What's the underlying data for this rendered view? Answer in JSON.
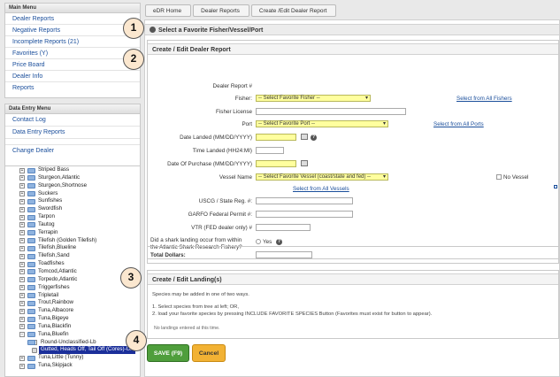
{
  "sidebar": {
    "main_menu": {
      "title": "Main Menu",
      "items": [
        "Dealer Reports",
        "Negative Reports",
        "Incomplete Reports (21)",
        "Favorites (Y)",
        "Price Board",
        "Dealer Info",
        "Reports"
      ]
    },
    "entry_menu": {
      "title": "Data Entry Menu",
      "items": [
        "Contact Log",
        "Data Entry Reports",
        "Change Dealer"
      ]
    },
    "species_tree": [
      {
        "label": "Striped Bass",
        "toggle": "+"
      },
      {
        "label": "Sturgeon,Atlantic",
        "toggle": "+"
      },
      {
        "label": "Sturgeon,Shortnose",
        "toggle": "+"
      },
      {
        "label": "Suckers",
        "toggle": "+"
      },
      {
        "label": "Sunfishes",
        "toggle": "+"
      },
      {
        "label": "Swordfish",
        "toggle": "+"
      },
      {
        "label": "Tarpon",
        "toggle": "+"
      },
      {
        "label": "Tautog",
        "toggle": "+"
      },
      {
        "label": "Terrapin",
        "toggle": "+"
      },
      {
        "label": "Tilefish (Golden Tilefish)",
        "toggle": "+"
      },
      {
        "label": "Tilefish,Blueline",
        "toggle": "+"
      },
      {
        "label": "Tilefish,Sand",
        "toggle": "+"
      },
      {
        "label": "Toadfishes",
        "toggle": "+"
      },
      {
        "label": "Tomcod,Atlantic",
        "toggle": "+"
      },
      {
        "label": "Torpedo,Atlantic",
        "toggle": "+"
      },
      {
        "label": "Triggerfishes",
        "toggle": "+"
      },
      {
        "label": "Tripletail",
        "toggle": "+"
      },
      {
        "label": "Trout,Rainbow",
        "toggle": "+"
      },
      {
        "label": "Tuna,Albacore",
        "toggle": "+"
      },
      {
        "label": "Tuna,Bigeye",
        "toggle": "+"
      },
      {
        "label": "Tuna,Blackfin",
        "toggle": "+"
      },
      {
        "label": "Tuna,Bluefin",
        "toggle": "−"
      },
      {
        "label": "Round-Unclassified-Lb",
        "toggle": "+",
        "child": true
      },
      {
        "label": "Gutted, Heads Off, Tail Off (Cores)-Un",
        "toggle": "",
        "child": true,
        "selected": true
      },
      {
        "label": "Tuna,Little (Tunny)",
        "toggle": "+"
      },
      {
        "label": "Tuna,Skipjack",
        "toggle": "+"
      }
    ]
  },
  "breadcrumb": [
    "eDR Home",
    "Dealer Reports",
    "Create /Edit Dealer Report"
  ],
  "favorite_section": {
    "title": "Select a Favorite Fisher/Vessel/Port"
  },
  "report_section": {
    "title": "Create / Edit Dealer Report",
    "labels": {
      "report_num": "Dealer Report #",
      "fisher": "Fisher:",
      "fisher_license": "Fisher License",
      "port": "Port",
      "date_landed": "Date Landed (MM/DD/YYYY)",
      "time_landed": "Time Landed (HH24:MI)",
      "date_purchase": "Date Of Purchase (MM/DD/YYYY)",
      "vessel_name": "Vessel Name",
      "usco": "USCG / State Reg. #:",
      "garfo": "GARFO Federal Permit #:",
      "vtr": "VTR (FED dealer only) #",
      "shark_q1": "Did a shark landing occur from within",
      "shark_q2": "the Atlantic Shark Research Fishery?",
      "yes": "Yes",
      "no_vessel": "No Vessel"
    },
    "selects": {
      "fisher": "-- Select Favorite Fisher --",
      "port": "-- Select Favorite Port --",
      "vessel": "-- Select Favorite Vessel (coast/state and fed) --"
    },
    "links": {
      "all_fishers": "Select from All Fishers",
      "all_ports": "Select from All Ports",
      "all_vessels": "Select from All Vessels"
    }
  },
  "total": {
    "label": "Total Dollars:"
  },
  "landings_section": {
    "title": "Create / Edit Landing(s)",
    "intro": "Species may be added in one of two ways.",
    "step1": "1. Select species from tree at left; OR,",
    "step2": "2. load your favorite species by pressing INCLUDE FAVORITE SPECIES Button (Favorites must exist for button to appear).",
    "empty": "No landings entered at this time."
  },
  "buttons": {
    "save": "SAVE (F9)",
    "cancel": "Cancel"
  },
  "callouts": [
    "1",
    "2",
    "3",
    "4"
  ],
  "colors": {
    "accent_link": "#1a4e9b",
    "required_yellow": "#ffff9e",
    "save_green": "#4f9e3c",
    "cancel_orange": "#f2b234",
    "tree_selected": "#1b2f9a"
  }
}
